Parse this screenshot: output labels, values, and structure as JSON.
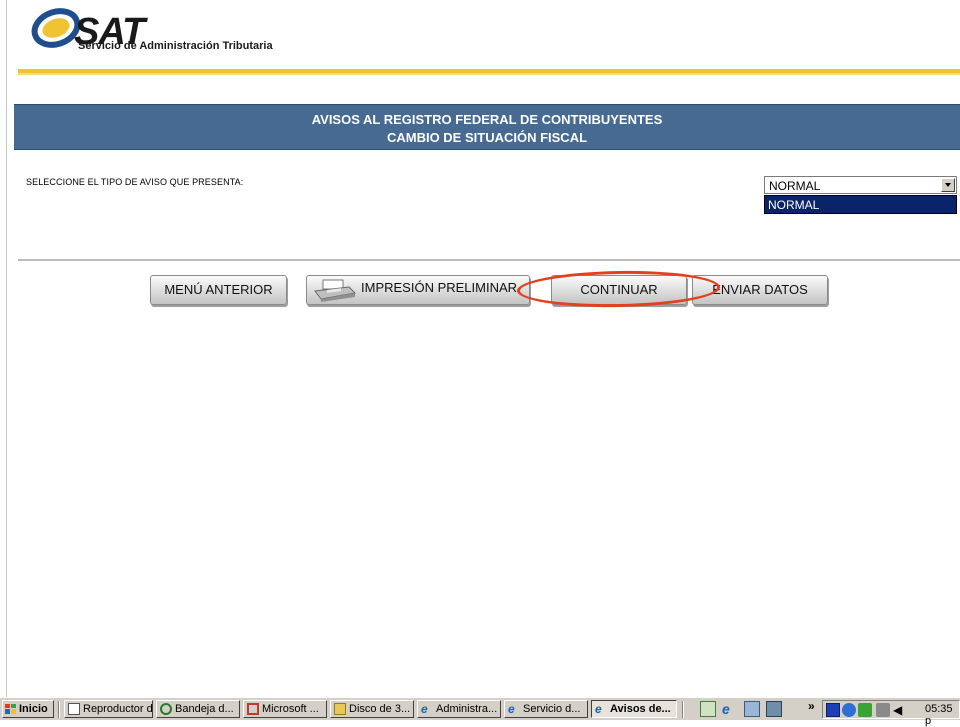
{
  "header": {
    "logo_text": "SAT",
    "logo_subtitle": "Servicio de Administración Tributaria"
  },
  "banner": {
    "line1": "AVISOS AL REGISTRO FEDERAL DE CONTRIBUYENTES",
    "line2": "CAMBIO DE SITUACIÓN FISCAL"
  },
  "form": {
    "prompt": "SELECCIONE EL TIPO DE AVISO QUE PRESENTA:",
    "selected": "NORMAL",
    "options": [
      "NORMAL"
    ]
  },
  "buttons": {
    "menu_anterior": "MENÚ ANTERIOR",
    "impresion_preliminar": "IMPRESIÓN PRELIMINAR",
    "continuar": "CONTINUAR",
    "enviar_datos": "ENVIAR DATOS"
  },
  "taskbar": {
    "start_label": "Inicio",
    "tasks": [
      {
        "label": "Reproductor d..."
      },
      {
        "label": "Bandeja d..."
      },
      {
        "label": "Microsoft ..."
      },
      {
        "label": "Disco de 3..."
      },
      {
        "label": "Administra..."
      },
      {
        "label": "Servicio d..."
      },
      {
        "label": "Avisos de..."
      }
    ],
    "overflow": "»",
    "clock": "05:35 p"
  },
  "colors": {
    "banner_bg": "#466a92",
    "gold_rule": "#f1c232",
    "highlight_ring": "#e2401f",
    "selection_bg": "#0a246a"
  }
}
